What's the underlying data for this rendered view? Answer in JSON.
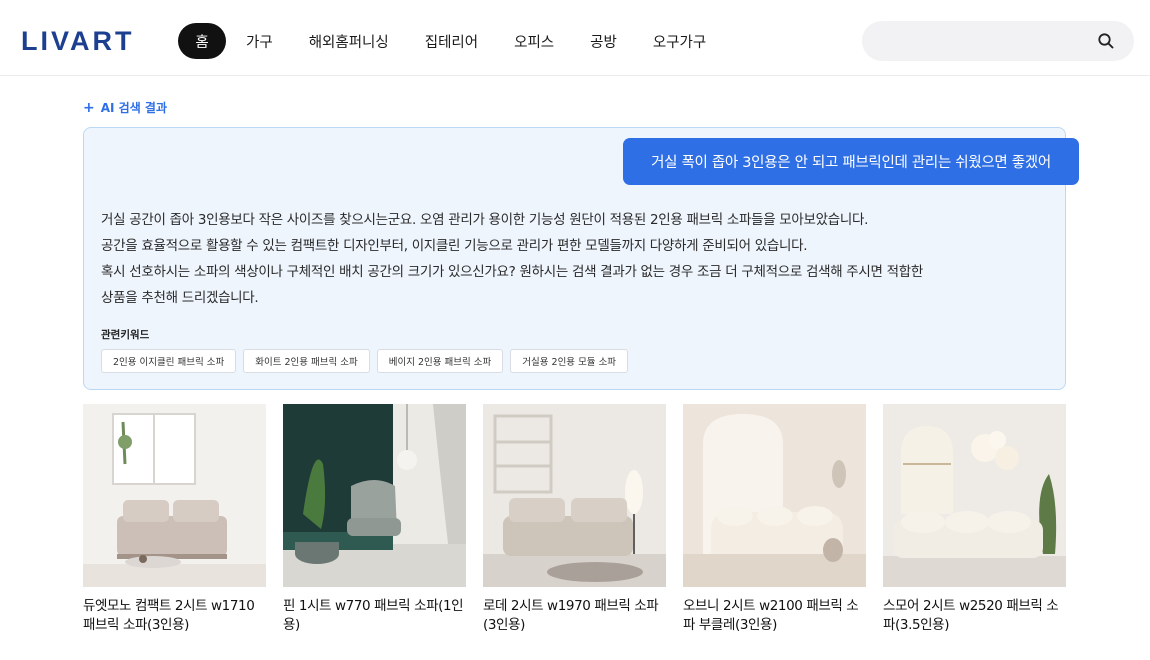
{
  "brand": {
    "logo_text": "LIVART"
  },
  "nav": {
    "items": [
      {
        "label": "홈",
        "active": true
      },
      {
        "label": "가구"
      },
      {
        "label": "해외홈퍼니싱"
      },
      {
        "label": "집테리어"
      },
      {
        "label": "오피스"
      },
      {
        "label": "공방"
      },
      {
        "label": "오구가구"
      }
    ]
  },
  "search": {
    "value": "",
    "icon": "search-icon"
  },
  "ai": {
    "label": "AI 검색 결과",
    "query": "거실 폭이 좁아 3인용은 안 되고 패브릭인데 관리는 쉬웠으면 좋겠어",
    "answer_lines": [
      "거실 공간이 좁아 3인용보다 작은 사이즈를 찾으시는군요. 오염 관리가 용이한 기능성 원단이 적용된 2인용 패브릭 소파들을 모아보았습니다.",
      "공간을 효율적으로 활용할 수 있는 컴팩트한 디자인부터, 이지클린 기능으로 관리가 편한 모델들까지 다양하게 준비되어 있습니다.",
      "혹시 선호하시는 소파의 색상이나 구체적인 배치 공간의 크기가 있으신가요? 원하시는 검색 결과가 없는 경우 조금 더 구체적으로 검색해 주시면 적합한",
      "상품을 추천해 드리겠습니다."
    ],
    "keywords_title": "관련키워드",
    "keywords": [
      "2인용 이지클린 패브릭 소파",
      "화이트 2인용 패브릭 소파",
      "베이지 2인용 패브릭 소파",
      "거실용 2인용 모듈 소파"
    ]
  },
  "colors": {
    "accent": "#2f6fe6",
    "panel_bg": "#eef5fd",
    "panel_border": "#bcd8f4",
    "nav_active_bg": "#111111"
  },
  "products": [
    {
      "name": "듀엣모노 컴팩트 2시트 w1710 패브릭 소파(3인용)"
    },
    {
      "name": "핀 1시트 w770 패브릭 소파(1인용)"
    },
    {
      "name": "로데 2시트 w1970 패브릭 소파(3인용)"
    },
    {
      "name": "오브니 2시트 w2100 패브릭 소파 부클레(3인용)"
    },
    {
      "name": "스모어 2시트 w2520 패브릭 소파(3.5인용)"
    }
  ]
}
